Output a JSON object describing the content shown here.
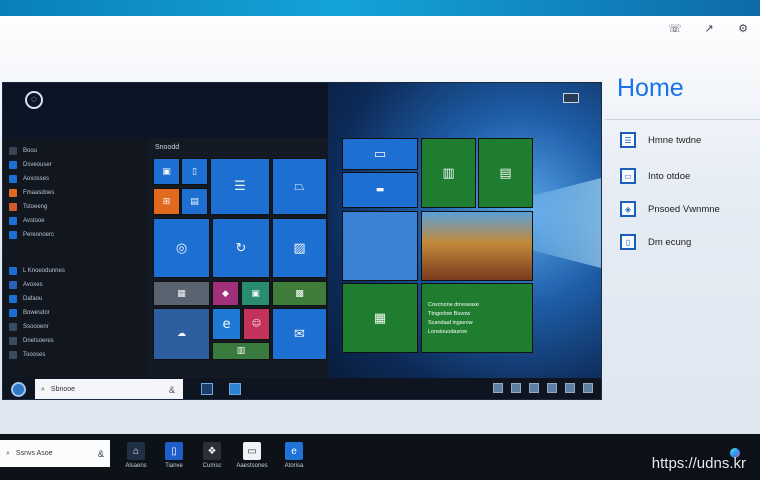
{
  "home_panel": {
    "title": "Home",
    "items": [
      {
        "label": "Hmne twdne",
        "icon": "list-icon"
      },
      {
        "label": "Into otdoe",
        "icon": "printer-icon"
      },
      {
        "label": "Pnsoed Vwnmne",
        "icon": "shield-icon"
      },
      {
        "label": "Dm ecung",
        "icon": "window-icon"
      }
    ]
  },
  "start_menu": {
    "header": "Snoodd",
    "sections": [
      {
        "label": "Boou"
      },
      {
        "label": "Dsveouser"
      },
      {
        "label": "Aoxosses"
      },
      {
        "label": "Fmaasdoes"
      },
      {
        "label": "Tstoeeng"
      },
      {
        "label": "Avstooe"
      },
      {
        "label": "Pereonoerc"
      },
      {
        "label": "L Knoeodunnes"
      },
      {
        "label": "Avoxes"
      },
      {
        "label": "Dafaou"
      },
      {
        "label": "Bowesdor"
      },
      {
        "label": "Ssoooenr"
      },
      {
        "label": "Dnetsoeres"
      },
      {
        "label": "Toooses"
      }
    ],
    "news_tile": {
      "lines": [
        "Covcnone drreoeaxe",
        "Ttngorlow Buvow",
        "Scandaal ingseow",
        "Lonsiouodasroe"
      ]
    }
  },
  "taskbar": {
    "search_text": "Sbnooe",
    "search_mic": "&"
  },
  "bottom_bar": {
    "search_text": "Ssnvs Asoe",
    "search_mic": "&",
    "apps": [
      {
        "label": "Alsaens",
        "icon": "home-icon",
        "color": "#1f2f44"
      },
      {
        "label": "Tianve",
        "icon": "tablet-icon",
        "color": "#1d5ec8"
      },
      {
        "label": "Cumsc",
        "icon": "apps-icon",
        "color": "#2a2f3a"
      },
      {
        "label": "Aaestsones",
        "icon": "file-icon",
        "color": "#f0f2f5"
      },
      {
        "label": "Atorisa",
        "icon": "edge-icon",
        "color": "#1f72d6"
      }
    ]
  },
  "watermark": "https://udns.kr",
  "accent_colors": {
    "home_title": "#1a73e8",
    "tile_blue": "#1d6fd1",
    "tile_green": "#1e7d2e",
    "tile_orange": "#e06a1f"
  }
}
